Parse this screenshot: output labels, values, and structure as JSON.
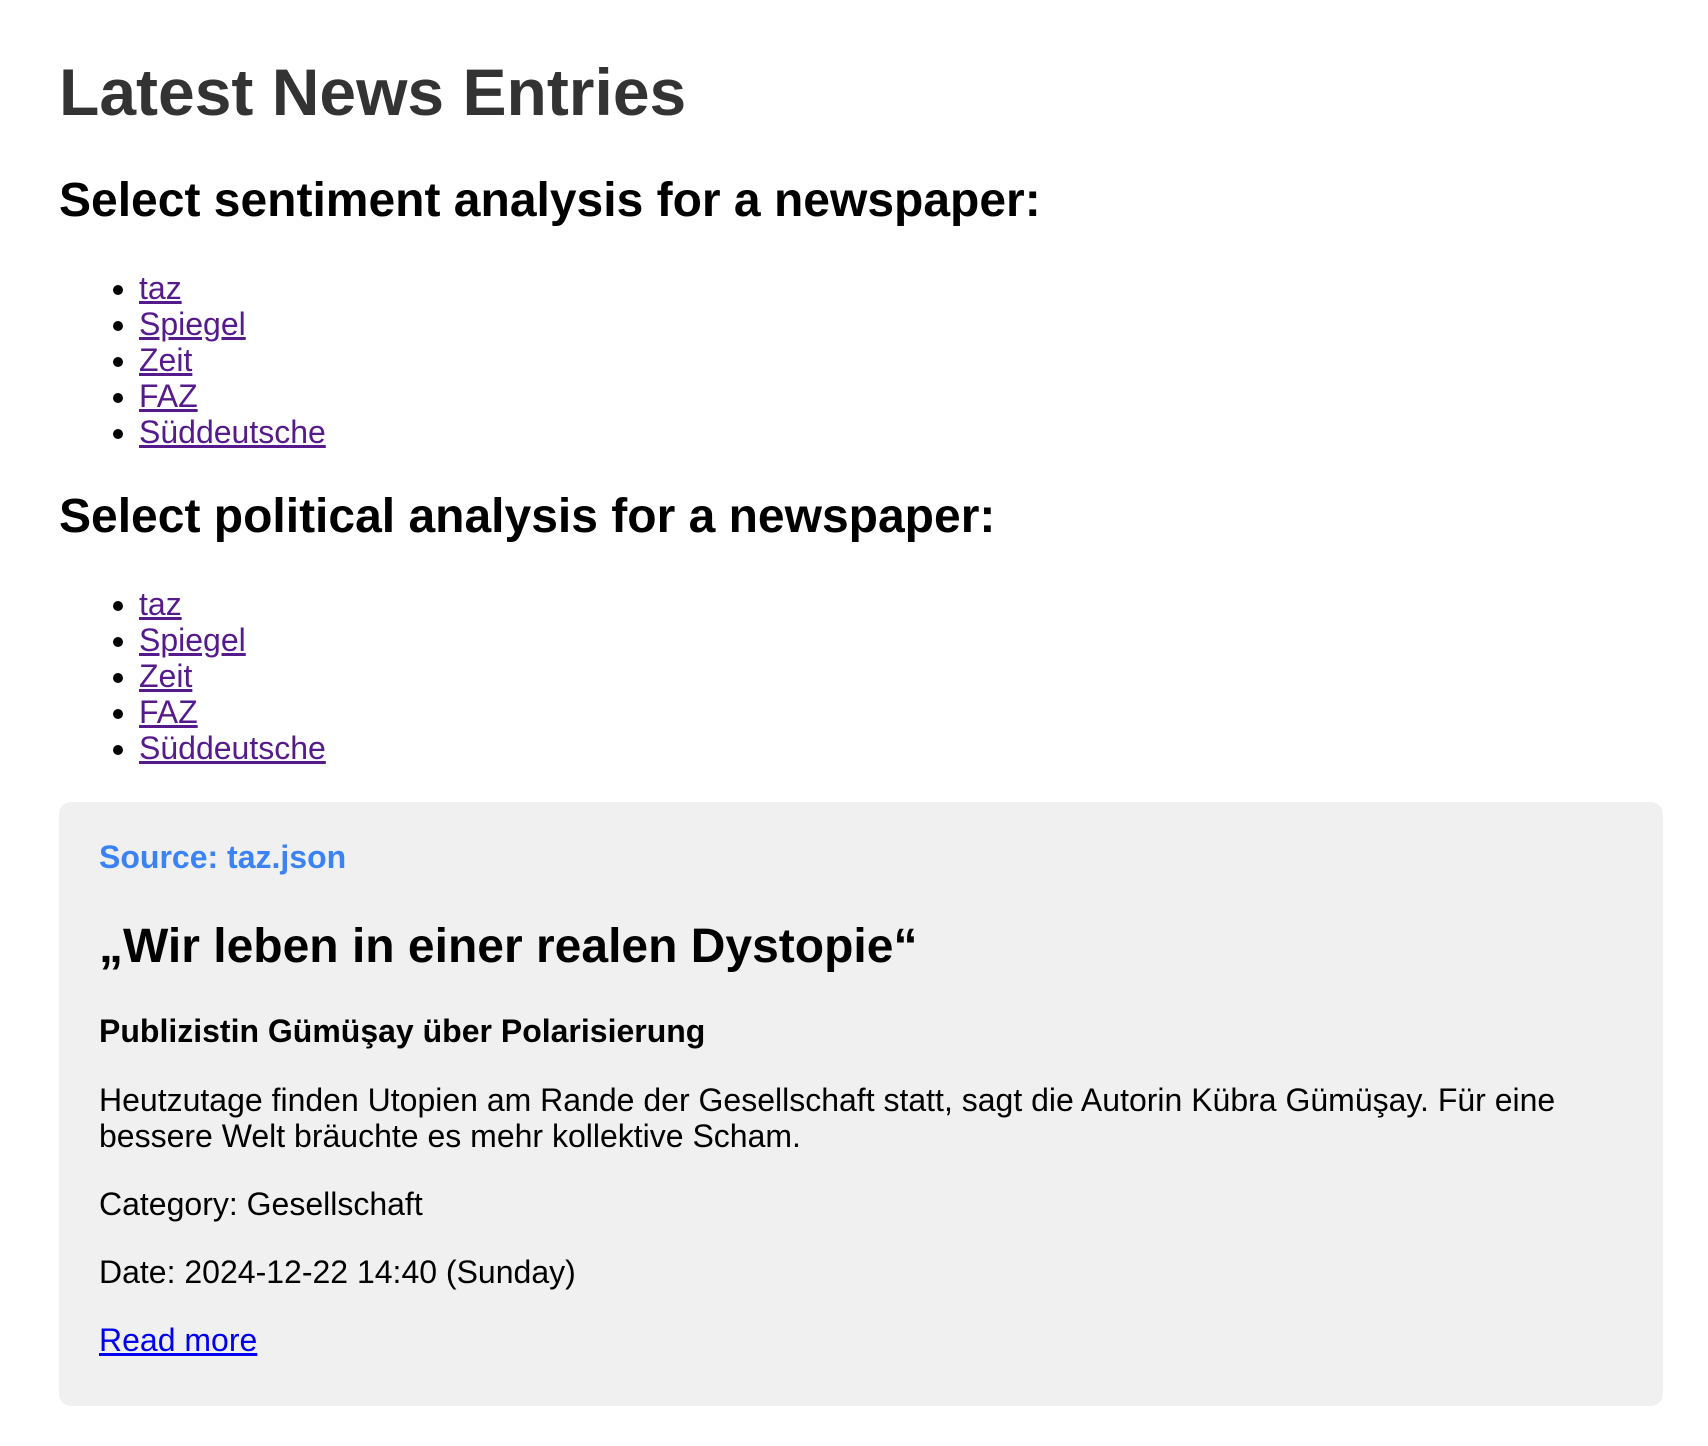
{
  "page": {
    "title": "Latest News Entries"
  },
  "sentiment": {
    "heading": "Select sentiment analysis for a newspaper:",
    "papers": [
      "taz",
      "Spiegel",
      "Zeit",
      "FAZ",
      "Süddeutsche"
    ]
  },
  "political": {
    "heading": "Select political analysis for a newspaper:",
    "papers": [
      "taz",
      "Spiegel",
      "Zeit",
      "FAZ",
      "Süddeutsche"
    ]
  },
  "article": {
    "source": "Source: taz.json",
    "title": "„Wir leben in einer realen Dystopie“",
    "subtitle": "Publizistin Gümüşay über Polarisierung",
    "teaser": "Heutzutage finden Utopien am Rande der Gesellschaft statt, sagt die Autorin Kübra Gümüşay. Für eine bessere Welt bräuchte es mehr kollektive Scham.",
    "category": "Category: Gesellschaft",
    "date": "Date: 2024-12-22 14:40 (Sunday)",
    "read_more": "Read more"
  },
  "colors": {
    "title": "#333333",
    "visited_link": "#551a8b",
    "link": "#0000ee",
    "source": "#3b82f6",
    "card_background": "#f0f0f0"
  }
}
